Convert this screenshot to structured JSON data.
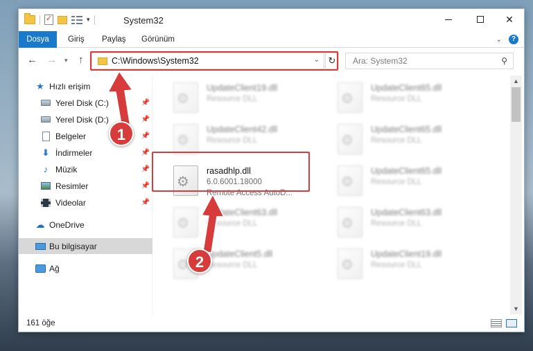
{
  "window": {
    "title": "System32",
    "accent_color": "#1979ca",
    "highlight_color": "#d63c3c"
  },
  "ribbon": {
    "file_tab": "Dosya",
    "tabs": [
      "Giriş",
      "Paylaş",
      "Görünüm"
    ]
  },
  "address": {
    "path": "C:\\Windows\\System32",
    "search_placeholder": "Ara: System32"
  },
  "sidebar": {
    "items": [
      {
        "label": "Hızlı erişim",
        "icon": "star-icon"
      },
      {
        "label": "Yerel Disk (C:)",
        "icon": "drive-icon"
      },
      {
        "label": "Yerel Disk (D:)",
        "icon": "drive-icon"
      },
      {
        "label": "Belgeler",
        "icon": "documents-icon"
      },
      {
        "label": "İndirmeler",
        "icon": "download-icon"
      },
      {
        "label": "Müzik",
        "icon": "music-icon"
      },
      {
        "label": "Resimler",
        "icon": "pictures-icon"
      },
      {
        "label": "Videolar",
        "icon": "videos-icon"
      },
      {
        "label": "OneDrive",
        "icon": "cloud-icon"
      },
      {
        "label": "Bu bilgisayar",
        "icon": "computer-icon"
      },
      {
        "label": "Ağ",
        "icon": "network-icon"
      }
    ]
  },
  "files": {
    "left": [
      {
        "name": "UpdateClient19.dll",
        "meta": "Resource DLL"
      },
      {
        "name": "UpdateClient42.dll",
        "meta": "Resource DLL"
      },
      {
        "name": "UpdateClient63.dll",
        "meta": "Resource DLL"
      },
      {
        "name": "UpdateClient5.dll",
        "meta": "Resource DLL"
      }
    ],
    "right": [
      {
        "name": "UpdateClient65.dll",
        "meta": "Resource DLL"
      },
      {
        "name": "UpdateClient65.dll",
        "meta": "Resource DLL"
      },
      {
        "name": "UpdateClient65.dll",
        "meta": "Resource DLL"
      },
      {
        "name": "UpdateClient63.dll",
        "meta": "Resource DLL"
      },
      {
        "name": "UpdateClient19.dll",
        "meta": "Resource DLL"
      }
    ],
    "selected": {
      "name": "rasadhlp.dll",
      "version": "6.0.6001.18000",
      "description": "Remote Access AutoD..."
    }
  },
  "status": {
    "item_count": "161 öğe"
  },
  "steps": [
    "1",
    "2"
  ]
}
